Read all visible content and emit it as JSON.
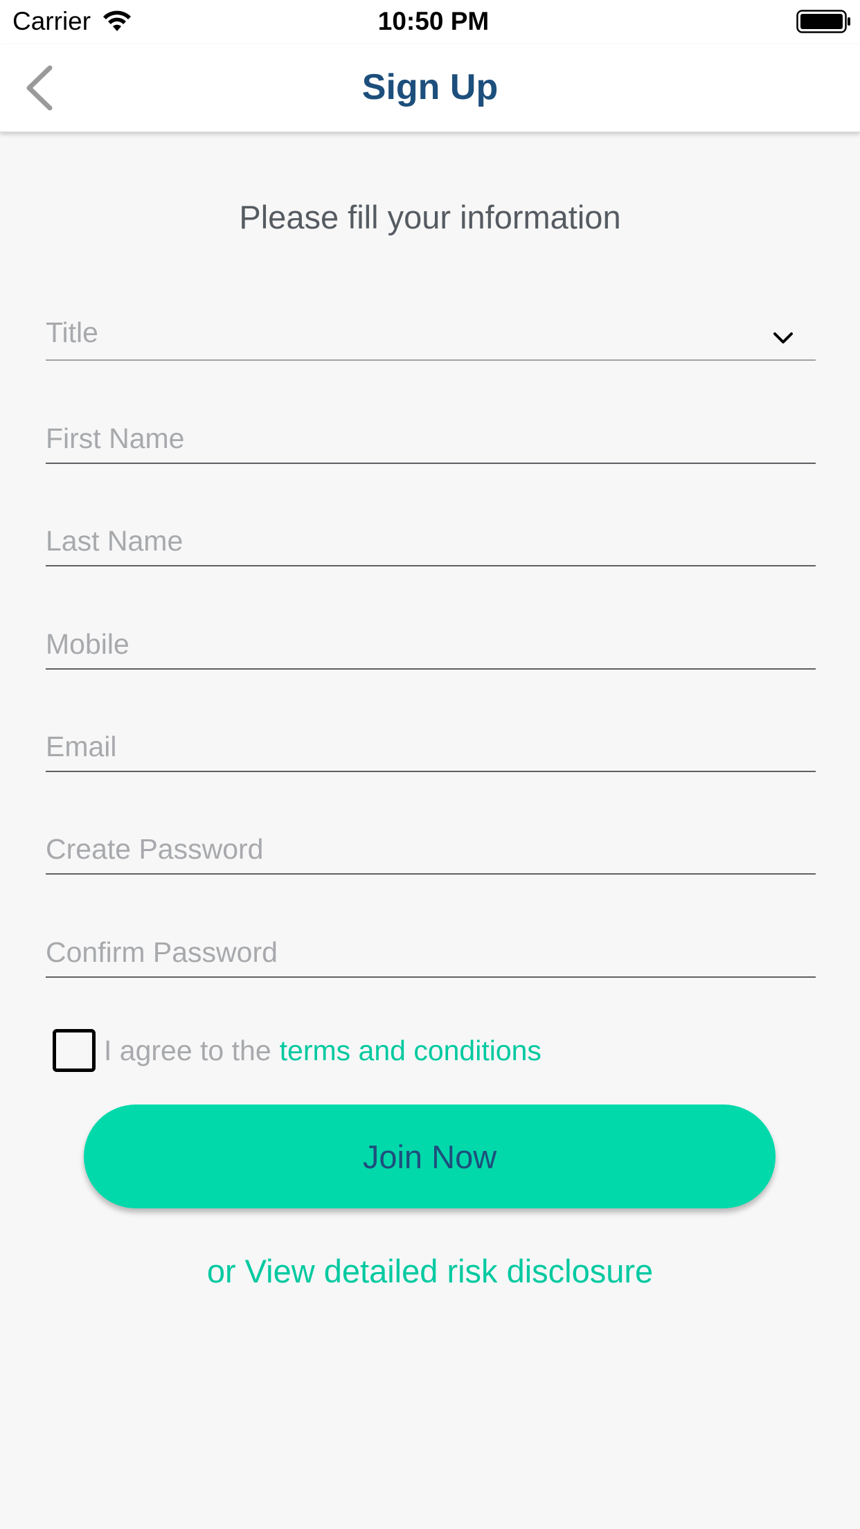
{
  "status_bar": {
    "carrier": "Carrier",
    "time": "10:50 PM",
    "icons": [
      "wifi-icon",
      "battery-icon"
    ]
  },
  "nav": {
    "title": "Sign Up",
    "back_icon": "chevron-left-icon"
  },
  "form": {
    "subtitle": "Please fill your information",
    "title_select": {
      "placeholder": "Title",
      "icon": "chevron-down-icon"
    },
    "first_name": {
      "placeholder": "First Name",
      "value": ""
    },
    "last_name": {
      "placeholder": "Last Name",
      "value": ""
    },
    "mobile": {
      "placeholder": "Mobile",
      "value": ""
    },
    "email": {
      "placeholder": "Email",
      "value": ""
    },
    "create_password": {
      "placeholder": "Create Password",
      "value": ""
    },
    "confirm_password": {
      "placeholder": "Confirm Password",
      "value": ""
    },
    "terms": {
      "prefix": "I agree to the",
      "link": "terms and conditions",
      "checked": false
    },
    "join_button": "Join Now",
    "risk_link": "or View detailed risk disclosure"
  },
  "colors": {
    "brand_navy": "#1d4f7c",
    "accent_green": "#02d9ab",
    "link_green": "#00c9a0",
    "placeholder_grey": "#a7a9ac",
    "background": "#f7f7f7"
  }
}
